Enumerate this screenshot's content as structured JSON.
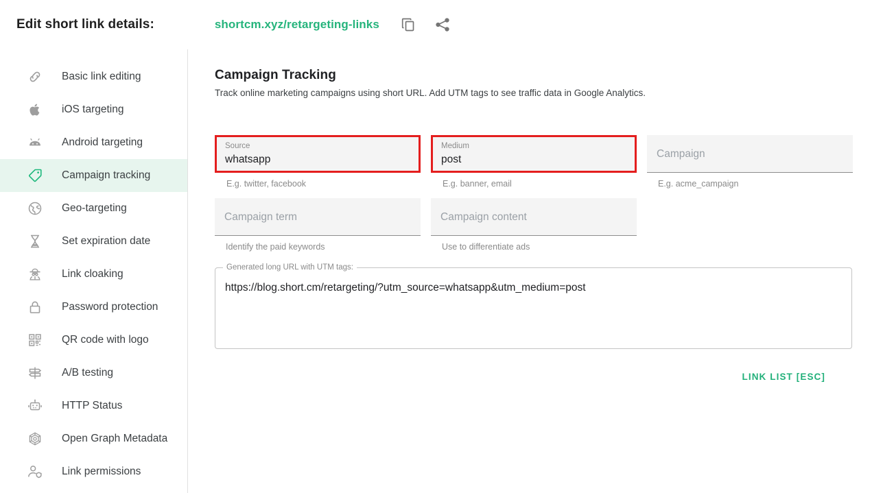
{
  "header": {
    "title": "Edit short link details:",
    "short_link": "shortcm.xyz/retargeting-links",
    "copy_icon": "copy-icon",
    "share_icon": "share-icon",
    "link_color": "#25b47c"
  },
  "sidebar": {
    "items": [
      {
        "label": "Basic link editing",
        "icon": "link-icon",
        "active": false
      },
      {
        "label": "iOS targeting",
        "icon": "apple-icon",
        "active": false
      },
      {
        "label": "Android targeting",
        "icon": "android-icon",
        "active": false
      },
      {
        "label": "Campaign tracking",
        "icon": "tag-icon",
        "active": true
      },
      {
        "label": "Geo-targeting",
        "icon": "globe-icon",
        "active": false
      },
      {
        "label": "Set expiration date",
        "icon": "hourglass-icon",
        "active": false
      },
      {
        "label": "Link cloaking",
        "icon": "spy-icon",
        "active": false
      },
      {
        "label": "Password protection",
        "icon": "lock-icon",
        "active": false
      },
      {
        "label": "QR code with logo",
        "icon": "qr-code-icon",
        "active": false
      },
      {
        "label": "A/B testing",
        "icon": "signpost-icon",
        "active": false
      },
      {
        "label": "HTTP Status",
        "icon": "robot-icon",
        "active": false
      },
      {
        "label": "Open Graph Metadata",
        "icon": "open-graph-icon",
        "active": false
      },
      {
        "label": "Link permissions",
        "icon": "user-shield-icon",
        "active": false
      }
    ],
    "active_bg": "#e7f5ee",
    "active_accent": "#1db87c"
  },
  "main": {
    "section_title": "Campaign Tracking",
    "section_subtitle": "Track online marketing campaigns using short URL. Add UTM tags to see traffic data in Google Analytics.",
    "highlight_color": "#e41e1e",
    "fields": {
      "source": {
        "label": "Source",
        "value": "whatsapp",
        "placeholder": "",
        "hint": "E.g. twitter, facebook",
        "highlighted": true,
        "filled": true
      },
      "medium": {
        "label": "Medium",
        "value": "post",
        "placeholder": "",
        "hint": "E.g. banner, email",
        "highlighted": true,
        "filled": true
      },
      "campaign": {
        "label": "",
        "value": "",
        "placeholder": "Campaign",
        "hint": "E.g. acme_campaign",
        "highlighted": false,
        "filled": false
      },
      "campaign_term": {
        "label": "",
        "value": "",
        "placeholder": "Campaign term",
        "hint": "Identify the paid keywords",
        "highlighted": false,
        "filled": false
      },
      "campaign_content": {
        "label": "",
        "value": "",
        "placeholder": "Campaign content",
        "hint": "Use to differentiate ads",
        "highlighted": false,
        "filled": false
      }
    },
    "generated_url": {
      "legend": "Generated long URL with UTM tags:",
      "value": "https://blog.short.cm/retargeting/?utm_source=whatsapp&utm_medium=post"
    },
    "link_list_label": "LINK LIST [ESC]",
    "link_list_color": "#22b07a"
  }
}
